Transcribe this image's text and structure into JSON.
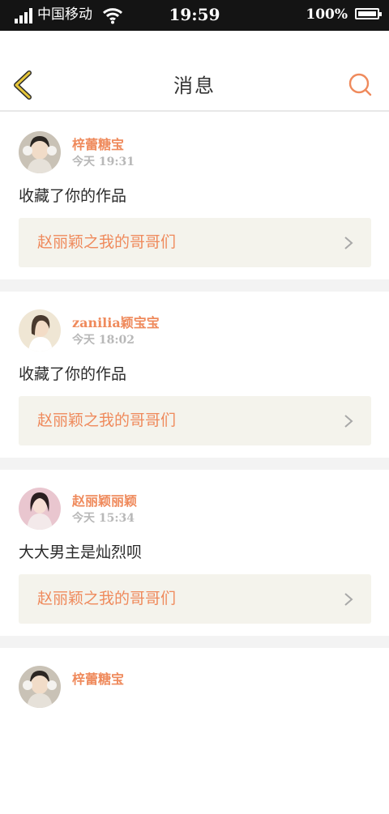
{
  "status_bar": {
    "carrier": "中国移动",
    "time": "19:59",
    "battery": "100%",
    "icons": [
      "signal-icon",
      "wifi-icon",
      "battery-icon"
    ]
  },
  "nav": {
    "title": "消息",
    "back_icon": "chevron-left-icon",
    "search_icon": "search-icon"
  },
  "colors": {
    "accent": "#ef8a5c",
    "back_arrow": "#e6c63a",
    "status_bar": "#141414",
    "link_bg": "#f4f3ec",
    "divider": "#f3f3f3"
  },
  "messages": [
    {
      "username": "梓蕾糖宝",
      "timestamp": "今天 19:31",
      "text": "收藏了你的作品",
      "work_title": "赵丽颖之我的哥哥们"
    },
    {
      "username": "zanilia颖宝宝",
      "timestamp": "今天 18:02",
      "text": "收藏了你的作品",
      "work_title": "赵丽颖之我的哥哥们"
    },
    {
      "username": "赵丽颖丽颖",
      "timestamp": "今天 15:34",
      "text": "大大男主是灿烈呗",
      "work_title": "赵丽颖之我的哥哥们"
    },
    {
      "username": "梓蕾糖宝",
      "timestamp": "",
      "text": "",
      "work_title": ""
    }
  ]
}
